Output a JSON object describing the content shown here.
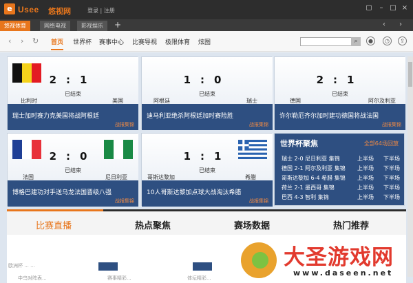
{
  "titlebar": {
    "logo_letter": "e",
    "brand": "Usee",
    "brand_cn": "悠视网",
    "login": "登录",
    "sep": "|",
    "register": "注册"
  },
  "tabs": [
    {
      "label": "悠视体育"
    },
    {
      "label": "网络电视"
    },
    {
      "label": "影视娱乐"
    }
  ],
  "tab_add": "+",
  "nav": {
    "menu": [
      "首页",
      "世界杯",
      "赛事中心",
      "比赛导视",
      "极限体育",
      "炫图"
    ],
    "search_placeholder": ""
  },
  "matches": [
    {
      "home": "比利时",
      "away": "美国",
      "score": "2:1",
      "status": "已结束",
      "desc": "瑞士加时赛力克美国将战阿根廷",
      "tag": "战报集锦",
      "home_flag": "belgium",
      "away_flag": "none"
    },
    {
      "home": "阿根廷",
      "away": "瑞士",
      "score": "1:0",
      "status": "已结束",
      "desc": "迪马利亚绝杀阿根廷加时赛险胜",
      "tag": "战报集锦",
      "home_flag": "none",
      "away_flag": "none"
    },
    {
      "home": "德国",
      "away": "阿尔及利亚",
      "score": "2:1",
      "status": "已结束",
      "desc": "许尔勒厄齐尔加时建功德国将战法国",
      "tag": "战报集锦",
      "home_flag": "none",
      "away_flag": "none"
    },
    {
      "home": "法国",
      "away": "尼日利亚",
      "score": "2:0",
      "status": "已结束",
      "desc": "博格巴建功对手送乌龙法国晋级八强",
      "tag": "战报集锦",
      "home_flag": "france",
      "away_flag": "nigeria"
    },
    {
      "home": "哥斯达黎加",
      "away": "希腊",
      "score": "1:1",
      "status": "已结束",
      "desc": "10人哥斯达黎加点球大战淘汰希腊",
      "tag": "战报集锦",
      "home_flag": "none",
      "away_flag": "greece"
    }
  ],
  "focus": {
    "title": "世界杯聚焦",
    "more": "全部64场回放",
    "rows": [
      {
        "match": "瑞士 2-0 尼日利亚 集锦",
        "h1": "上半场",
        "h2": "下半场"
      },
      {
        "match": "德国 2-1 阿尔及利亚 集锦",
        "h1": "上半场",
        "h2": "下半场"
      },
      {
        "match": "哥斯达黎加 6-4 希腊 集锦",
        "h1": "上半场",
        "h2": "下半场"
      },
      {
        "match": "荷兰 2-1 墨西哥 集锦",
        "h1": "上半场",
        "h2": "下半场"
      },
      {
        "match": "巴西 4-3 智利 集锦",
        "h1": "上半场",
        "h2": "下半场"
      }
    ]
  },
  "sections": [
    "比赛直播",
    "热点聚焦",
    "赛场数据",
    "热门推荐"
  ],
  "strip": {
    "left_top": "欧洲杯 ...  ...",
    "left_bottom": "中乌对阵表...",
    "mid_bottom": "赛事精彩...",
    "right_bottom": "体坛精彩..."
  },
  "watermark": {
    "title": "大圣游戏网",
    "url": "www.daseen.net"
  },
  "colors": {
    "accent": "#e8761c",
    "card_blue": "#2e4f81",
    "dark": "#2d2d2d"
  }
}
